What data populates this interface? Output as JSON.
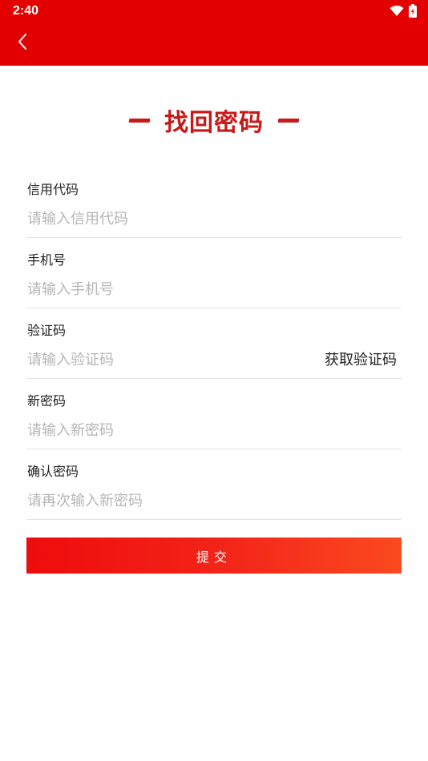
{
  "status_bar": {
    "time": "2:40",
    "icons": [
      "wifi-icon",
      "battery-charging-icon"
    ]
  },
  "header": {
    "back_icon": "chevron-left-icon"
  },
  "page": {
    "title": "找回密码"
  },
  "form": {
    "fields": [
      {
        "label": "信用代码",
        "placeholder": "请输入信用代码",
        "value": ""
      },
      {
        "label": "手机号",
        "placeholder": "请输入手机号",
        "value": ""
      },
      {
        "label": "验证码",
        "placeholder": "请输入验证码",
        "value": ""
      },
      {
        "label": "新密码",
        "placeholder": "请输入新密码",
        "value": ""
      },
      {
        "label": "确认密码",
        "placeholder": "请再次输入新密码",
        "value": ""
      }
    ],
    "get_code_label": "获取验证码",
    "submit_label": "提交"
  },
  "colors": {
    "header_bg": "#e30000",
    "title": "#c81818",
    "placeholder": "#b6b6b6",
    "button_gradient_start": "#ee0c0c",
    "button_gradient_end": "#fb4a1f"
  }
}
